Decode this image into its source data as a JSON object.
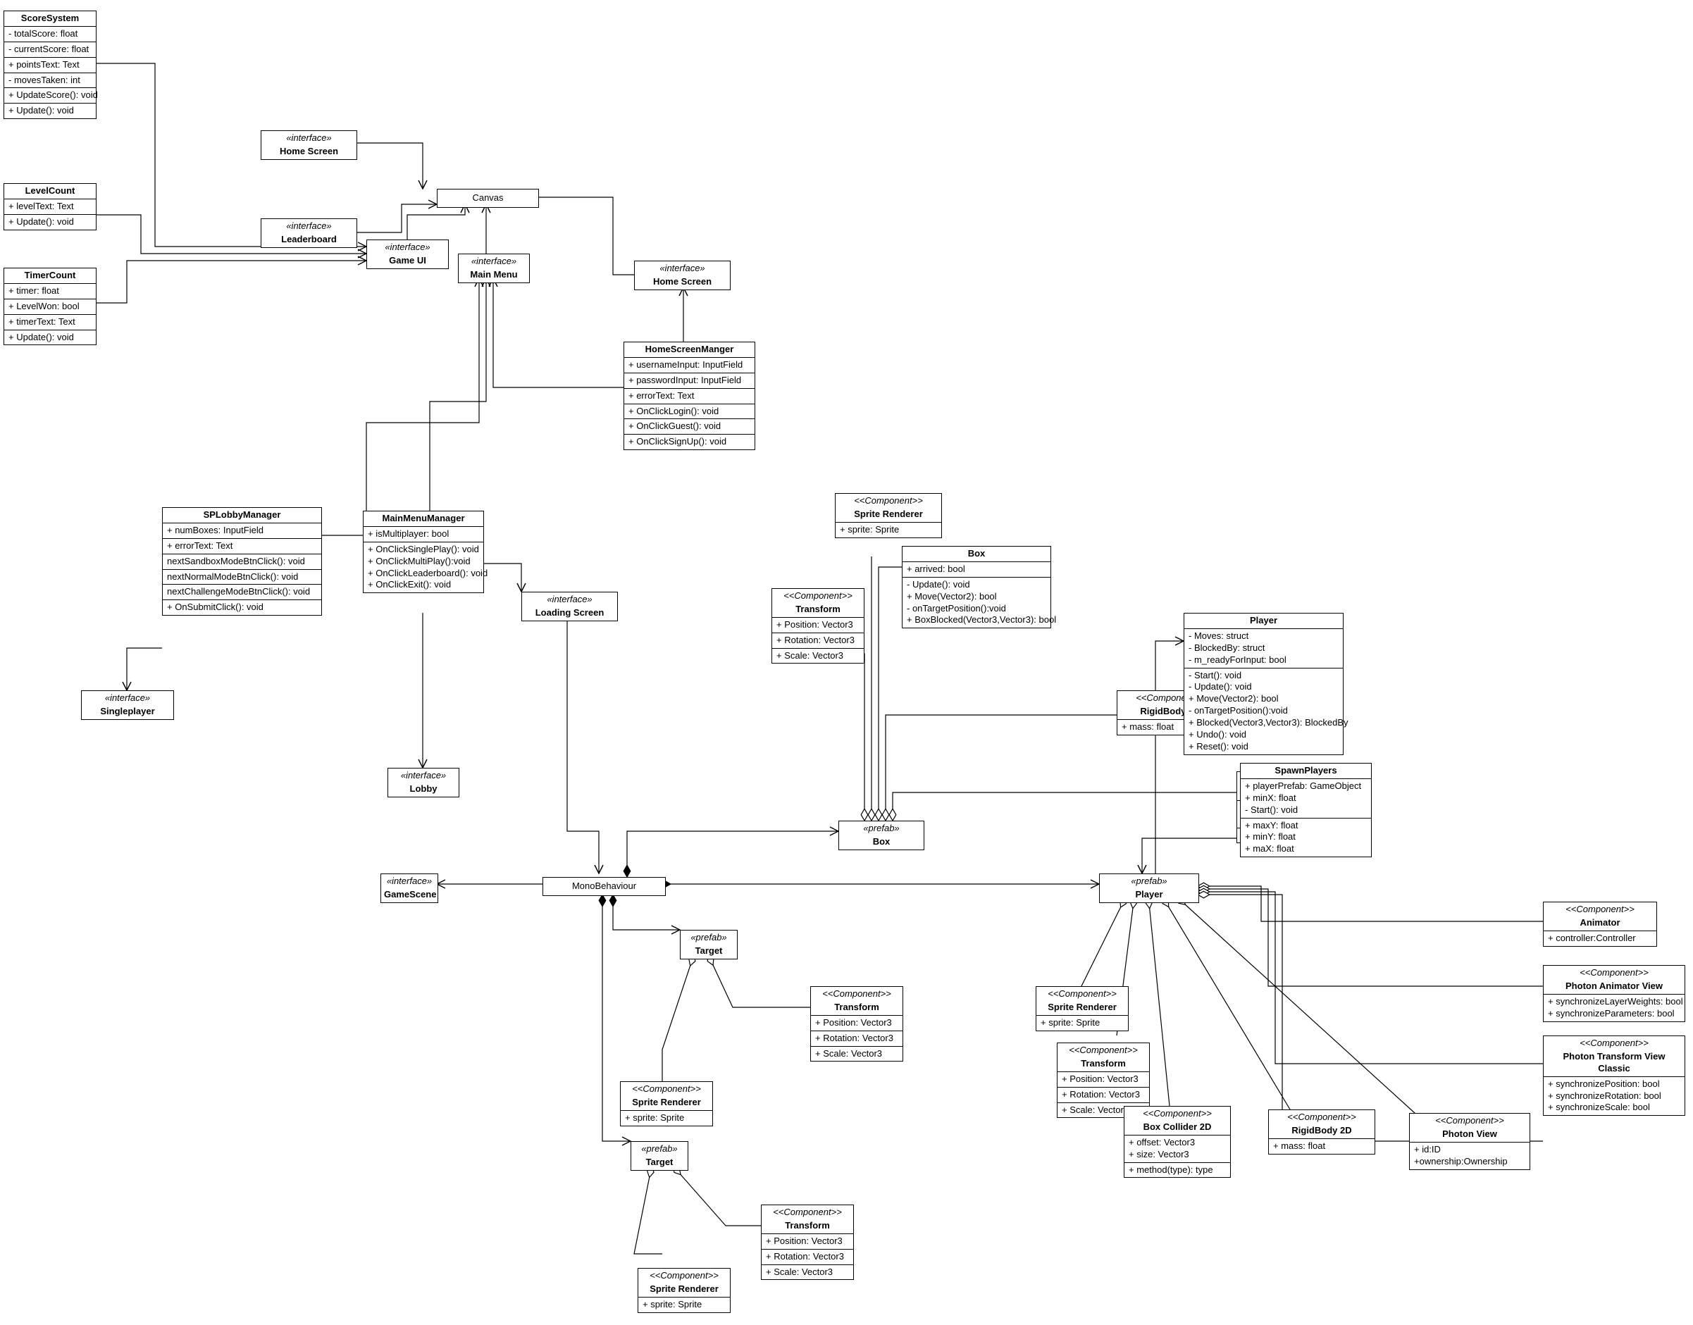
{
  "labels": {
    "interface": "«interface»",
    "prefab": "«prefab»",
    "component": "<<Component>>"
  },
  "ScoreSystem": {
    "name": "ScoreSystem",
    "a1": "- totalScore: float",
    "a2": "- currentScore: float",
    "a3": "+ pointsText: Text",
    "a4": "- movesTaken: int",
    "m1": "+ UpdateScore(): void",
    "m2": "+ Update(): void"
  },
  "LevelCount": {
    "name": "LevelCount",
    "a1": "+ levelText: Text",
    "m1": "+ Update(): void"
  },
  "TimerCount": {
    "name": "TimerCount",
    "a1": "+ timer: float",
    "a2": "+ LevelWon: bool",
    "a3": "+ timerText: Text",
    "m1": "+ Update(): void"
  },
  "HomeScreen1": "Home Screen",
  "Leaderboard": "Leaderboard",
  "GameUI": "Game UI",
  "Canvas": "Canvas",
  "MainMenu": "Main Menu",
  "HomeScreen2": "Home Screen",
  "HomeScreenManager": {
    "name": "HomeScreenManger",
    "a1": "+ usernameInput: InputField",
    "a2": "+ passwordInput: InputField",
    "a3": "+ errorText: Text",
    "m1": "+ OnClickLogin(): void",
    "m2": "+ OnClickGuest(): void",
    "m3": "+ OnClickSignUp(): void"
  },
  "SPLobbyManager": {
    "name": "SPLobbyManager",
    "a1": "+ numBoxes: InputField",
    "a2": "+ errorText: Text",
    "m1": "nextSandboxModeBtnClick(): void",
    "m2": "nextNormalModeBtnClick(): void",
    "m3": "nextChallengeModeBtnClick(): void",
    "m4": "+ OnSubmitClick(): void"
  },
  "Singleplayer": "Singleplayer",
  "MainMenuManager": {
    "name": "MainMenuManager",
    "a1": "+ isMultiplayer: bool",
    "m1": "+ OnClickSinglePlay(): void",
    "m2": "+ OnClickMultiPlay():void",
    "m3": "+ OnClickLeaderboard(): void",
    "m4": "+ OnClickExit(): void"
  },
  "LoadingScreen": "Loading Screen",
  "Lobby": "Lobby",
  "SpriteRenderer": {
    "name": "Sprite Renderer",
    "a1": "+ sprite: Sprite"
  },
  "Transform": {
    "name": "Transform",
    "a1": "+ Position: Vector3",
    "a2": "+ Rotation: Vector3",
    "a3": "+ Scale: Vector3"
  },
  "Box": {
    "name": "Box",
    "a1": "+ arrived: bool",
    "m1": "- Update(): void",
    "m2": "+ Move(Vector2): bool",
    "m3": "- onTargetPosition():void",
    "m4": "+ BoxBlocked(Vector3,Vector3): bool"
  },
  "RigidBody2D": {
    "name": "RigidBody 2D",
    "a1": "+ mass: float"
  },
  "BoxCollider2D": {
    "name": "Box Collider 2D",
    "a1": "+ offset: Vector3",
    "a2": "+ size: Vector3",
    "m1": "+ method(type): type"
  },
  "PrefabBox": "Box",
  "Player": {
    "name": "Player",
    "a1": "- Moves: struct",
    "a2": "- BlockedBy: struct",
    "a3": "- m_readyForInput: bool",
    "m1": "- Start(): void",
    "m2": "- Update(): void",
    "m3": "+ Move(Vector2): bool",
    "m4": "- onTargetPosition():void",
    "m5": "+ Blocked(Vector3,Vector3): BlockedBy",
    "m6": "+ Undo(): void",
    "m7": "+ Reset(): void"
  },
  "SpawnPlayers": {
    "name": "SpawnPlayers",
    "a1": "+ playerPrefab: GameObject",
    "a2": "+ minX: float",
    "a3": "- Start(): void",
    "a4": "+ maxY: float",
    "a5": "+ minY: float",
    "a6": "+ maX: float"
  },
  "GameScene": "GameScene",
  "MonoBehaviour": "MonoBehaviour",
  "PrefabPlayer": "Player",
  "PrefabTarget": "Target",
  "Animator": {
    "name": "Animator",
    "a1": "+ controller:Controller"
  },
  "PhotonAnimatorView": {
    "name": "Photon Animator View",
    "a1": "+ synchronizeLayerWeights: bool",
    "a2": "+ synchronizeParameters: bool"
  },
  "PhotonTransformViewClassic": {
    "name": "Photon Transform View Classic",
    "a1": "+ synchronizePosition: bool",
    "a2": "+ synchronizeRotation: bool",
    "a3": "+ synchronizeScale: bool"
  },
  "PhotonView": {
    "name": "Photon View",
    "a1": "+ id:ID",
    "a2": "+ownership:Ownership"
  }
}
